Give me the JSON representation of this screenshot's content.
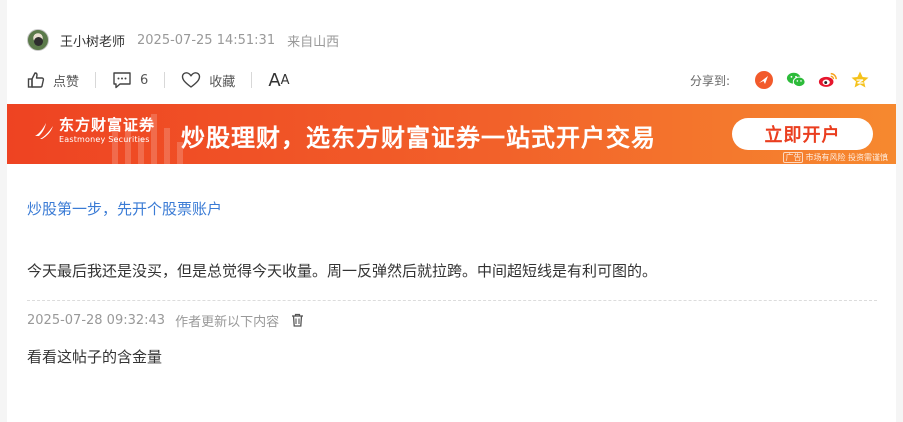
{
  "author": {
    "name": "王小树老师",
    "time": "2025-07-25 14:51:31",
    "from": "来自山西"
  },
  "actions": {
    "like_label": "点赞",
    "comment_count": "6",
    "favorite_label": "收藏",
    "font_size_label_big": "A",
    "font_size_label_small": "A"
  },
  "share": {
    "label": "分享到:",
    "targets": [
      "circle-icon",
      "wechat-icon",
      "weibo-icon",
      "qzone-icon"
    ]
  },
  "banner": {
    "brand_cn": "东方财富证券",
    "brand_en": "Eastmoney Securities",
    "slogan": "炒股理财，选东方财富证券一站式开户交易",
    "cta": "立即开户",
    "ad_tag": "广告",
    "ad_note": "市场有风险 投资需谨慎",
    "colors": {
      "start": "#ee4322",
      "end": "#f6892f",
      "cta_text": "#ea3e1f"
    }
  },
  "promo_link": "炒股第一步，先开个股票账户",
  "body": "今天最后我还是没买，但是总觉得今天收量。周一反弹然后就拉跨。中间超短线是有利可图的。",
  "update": {
    "time": "2025-07-28 09:32:43",
    "note": "作者更新以下内容",
    "text": "看看这帖子的含金量"
  }
}
